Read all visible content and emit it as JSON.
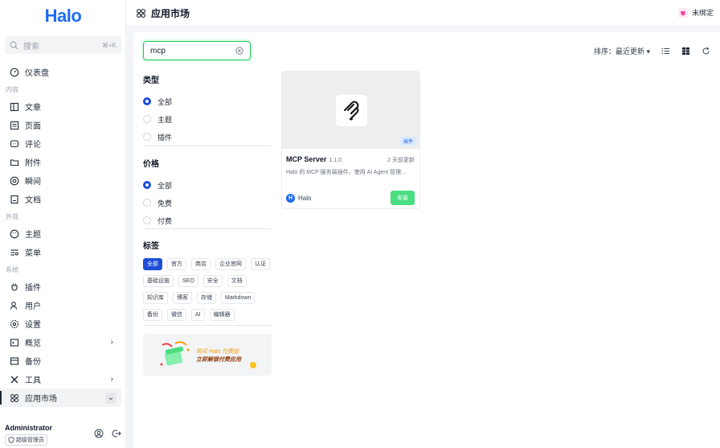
{
  "sidebar": {
    "logo": "Halo",
    "search": {
      "placeholder": "搜索",
      "shortcut": "⌘+K"
    },
    "dashboard": "仪表盘",
    "groups": {
      "content": "内容",
      "appearance": "外观",
      "system": "系统"
    },
    "items": {
      "posts": "文章",
      "pages": "页面",
      "comments": "评论",
      "attachments": "附件",
      "moments": "瞬间",
      "docs": "文档",
      "themes": "主题",
      "menus": "菜单",
      "plugins": "插件",
      "users": "用户",
      "settings": "设置",
      "overview": "概览",
      "backups": "备份",
      "tools": "工具",
      "app_market": "应用市场"
    },
    "user": {
      "name": "Administrator",
      "role": "超级管理员"
    }
  },
  "header": {
    "title": "应用市场",
    "bind_label": "未绑定"
  },
  "main": {
    "search_value": "mcp",
    "sort_label": "排序：最近更新",
    "filters": {
      "type": {
        "title": "类型",
        "options": [
          "全部",
          "主题",
          "插件"
        ],
        "selected": "全部"
      },
      "price": {
        "title": "价格",
        "options": [
          "全部",
          "免费",
          "付费"
        ],
        "selected": "全部"
      },
      "tags": {
        "title": "标签",
        "items": [
          "全部",
          "官方",
          "商店",
          "企业官网",
          "认证",
          "基础设施",
          "SEO",
          "安全",
          "文档",
          "知识库",
          "博客",
          "存储",
          "Markdown",
          "备份",
          "微信",
          "AI",
          "编辑器"
        ],
        "selected": "全部"
      }
    },
    "promo": {
      "line1": "购买 Halo 付费版",
      "line2": "立即解锁付费应用"
    },
    "cards": [
      {
        "name": "MCP Server",
        "version": "1.1.0",
        "updated": "2 天前更新",
        "type": "插件",
        "description": "Halo 的 MCP 服务端插件，使用 AI Agent 管理...",
        "author": "Halo",
        "author_initial": "H",
        "action": "安装"
      }
    ]
  },
  "colors": {
    "brand": "#1d6bf2",
    "accent": "#1d4ed8",
    "install": "#4ade80",
    "search_border": "#22c55e"
  }
}
